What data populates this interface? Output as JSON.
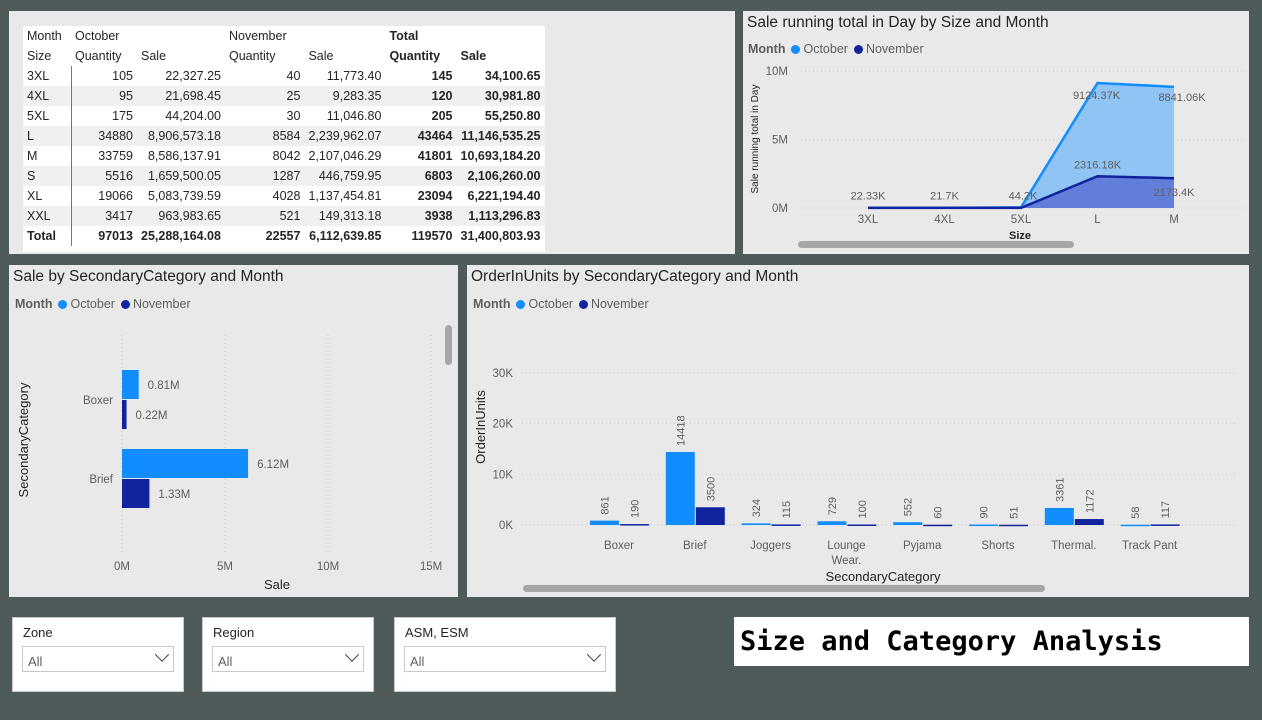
{
  "matrix": {
    "header_row1": [
      "Month",
      "October",
      "",
      "November",
      "",
      "Total",
      ""
    ],
    "header_row2": [
      "Size",
      "Quantity",
      "Sale",
      "Quantity",
      "Sale",
      "Quantity",
      "Sale"
    ],
    "rows": [
      [
        "3XL",
        "105",
        "22,327.25",
        "40",
        "11,773.40",
        "145",
        "34,100.65"
      ],
      [
        "4XL",
        "95",
        "21,698.45",
        "25",
        "9,283.35",
        "120",
        "30,981.80"
      ],
      [
        "5XL",
        "175",
        "44,204.00",
        "30",
        "11,046.80",
        "205",
        "55,250.80"
      ],
      [
        "L",
        "34880",
        "8,906,573.18",
        "8584",
        "2,239,962.07",
        "43464",
        "11,146,535.25"
      ],
      [
        "M",
        "33759",
        "8,586,137.91",
        "8042",
        "2,107,046.29",
        "41801",
        "10,693,184.20"
      ],
      [
        "S",
        "5516",
        "1,659,500.05",
        "1287",
        "446,759.95",
        "6803",
        "2,106,260.00"
      ],
      [
        "XL",
        "19066",
        "5,083,739.59",
        "4028",
        "1,137,454.81",
        "23094",
        "6,221,194.40"
      ],
      [
        "XXL",
        "3417",
        "963,983.65",
        "521",
        "149,313.18",
        "3938",
        "1,113,296.83"
      ]
    ],
    "total": [
      "Total",
      "97013",
      "25,288,164.08",
      "22557",
      "6,112,639.85",
      "119570",
      "31,400,803.93"
    ]
  },
  "legend": {
    "title": "Month",
    "october": "October",
    "november": "November"
  },
  "colors": {
    "october": "#118dff",
    "november": "#12239e"
  },
  "running_total": {
    "title": "Sale running total in Day by Size and Month",
    "chart_data": {
      "type": "area",
      "x": [
        "3XL",
        "4XL",
        "5XL",
        "L",
        "M"
      ],
      "xlabel": "Size",
      "ylabel": "Sale running total in Day",
      "y_ticks": [
        "10M",
        "5M",
        "0M"
      ],
      "ylim": [
        0,
        10000000
      ],
      "series": [
        {
          "name": "October",
          "values": [
            22330,
            21700,
            44200,
            9124370,
            8841060
          ],
          "labels": [
            "22.33K",
            "21.7K",
            "44.2K",
            "9124.37K",
            "8841.06K"
          ]
        },
        {
          "name": "November",
          "values": [
            11770,
            9280,
            11050,
            2316180,
            2173400
          ],
          "labels": [
            "",
            "",
            "",
            "2316.18K",
            "2173.4K"
          ]
        }
      ]
    }
  },
  "sale_by_cat": {
    "title": "Sale by SecondaryCategory and Month",
    "chart_data": {
      "type": "bar",
      "orientation": "horizontal",
      "categories": [
        "Boxer",
        "Brief"
      ],
      "series": [
        {
          "name": "October",
          "values": [
            0.81,
            6.12
          ],
          "labels": [
            "0.81M",
            "6.12M"
          ]
        },
        {
          "name": "November",
          "values": [
            0.22,
            1.33
          ],
          "labels": [
            "0.22M",
            "1.33M"
          ]
        }
      ],
      "xlim": [
        0,
        15
      ],
      "x_ticks": [
        "0M",
        "5M",
        "10M",
        "15M"
      ],
      "xlabel": "Sale",
      "ylabel": "SecondaryCategory"
    }
  },
  "orders_by_cat": {
    "title": "OrderInUnits by SecondaryCategory and Month",
    "chart_data": {
      "type": "bar",
      "categories": [
        "Boxer",
        "Brief",
        "Joggers",
        "Lounge Wear.",
        "Pyjama",
        "Shorts",
        "Thermal.",
        "Track Pant"
      ],
      "series": [
        {
          "name": "October",
          "values": [
            861,
            14418,
            324,
            729,
            552,
            90,
            3361,
            58
          ]
        },
        {
          "name": "November",
          "values": [
            190,
            3500,
            115,
            100,
            60,
            51,
            1172,
            117
          ]
        }
      ],
      "ylim": [
        0,
        30000
      ],
      "y_ticks": [
        "30K",
        "20K",
        "10K",
        "0K"
      ],
      "xlabel": "SecondaryCategory",
      "ylabel": "OrderInUnits"
    }
  },
  "slicers": [
    {
      "title": "Zone",
      "value": "All"
    },
    {
      "title": "Region",
      "value": "All"
    },
    {
      "title": "ASM, ESM",
      "value": "All"
    }
  ],
  "page_title": "Size and Category Analysis"
}
